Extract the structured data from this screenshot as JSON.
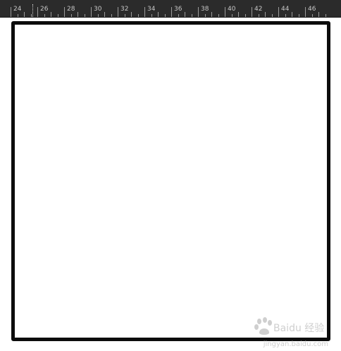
{
  "ruler": {
    "labels": [
      "24",
      "26",
      "28",
      "30",
      "32",
      "34",
      "36",
      "38",
      "40",
      "42",
      "44",
      "46"
    ]
  },
  "watermark": {
    "brand": "Baidu 经验",
    "url": "jingyan.baidu.com"
  },
  "colors": {
    "ruler_bg": "#2b2b2b",
    "ruler_text": "#c8c8c8",
    "frame_border": "#0c0c0c",
    "canvas_bg": "#ffffff",
    "watermark": "#cfcfcf"
  }
}
